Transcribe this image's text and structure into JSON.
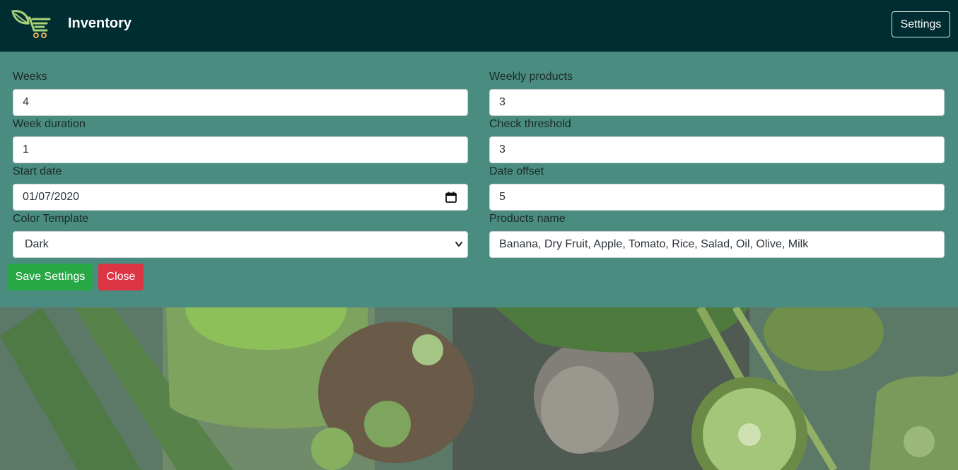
{
  "navbar": {
    "brand": "Inventory",
    "settings_button": "Settings"
  },
  "settings_form": {
    "weeks": {
      "label": "Weeks",
      "value": "4"
    },
    "weekly_products": {
      "label": "Weekly products",
      "value": "3"
    },
    "week_duration": {
      "label": "Week duration",
      "value": "1"
    },
    "check_threshold": {
      "label": "Check threshold",
      "value": "3"
    },
    "start_date": {
      "label": "Start date",
      "value": "01/07/2020"
    },
    "date_offset": {
      "label": "Date offset",
      "value": "5"
    },
    "color_template": {
      "label": "Color Template",
      "value": "Dark"
    },
    "products_name": {
      "label": "Products name",
      "value": "Banana, Dry Fruit, Apple, Tomato, Rice, Salad, Oil, Olive, Milk"
    },
    "save_button": "Save Settings",
    "close_button": "Close"
  },
  "colors": {
    "navbar_bg": "#002d31",
    "panel_bg": "#4a8c80",
    "save_button": "#28a745",
    "close_button": "#dc3545"
  },
  "icons": [
    "leaf-cart-logo-icon",
    "calendar-icon",
    "chevron-down-icon"
  ]
}
